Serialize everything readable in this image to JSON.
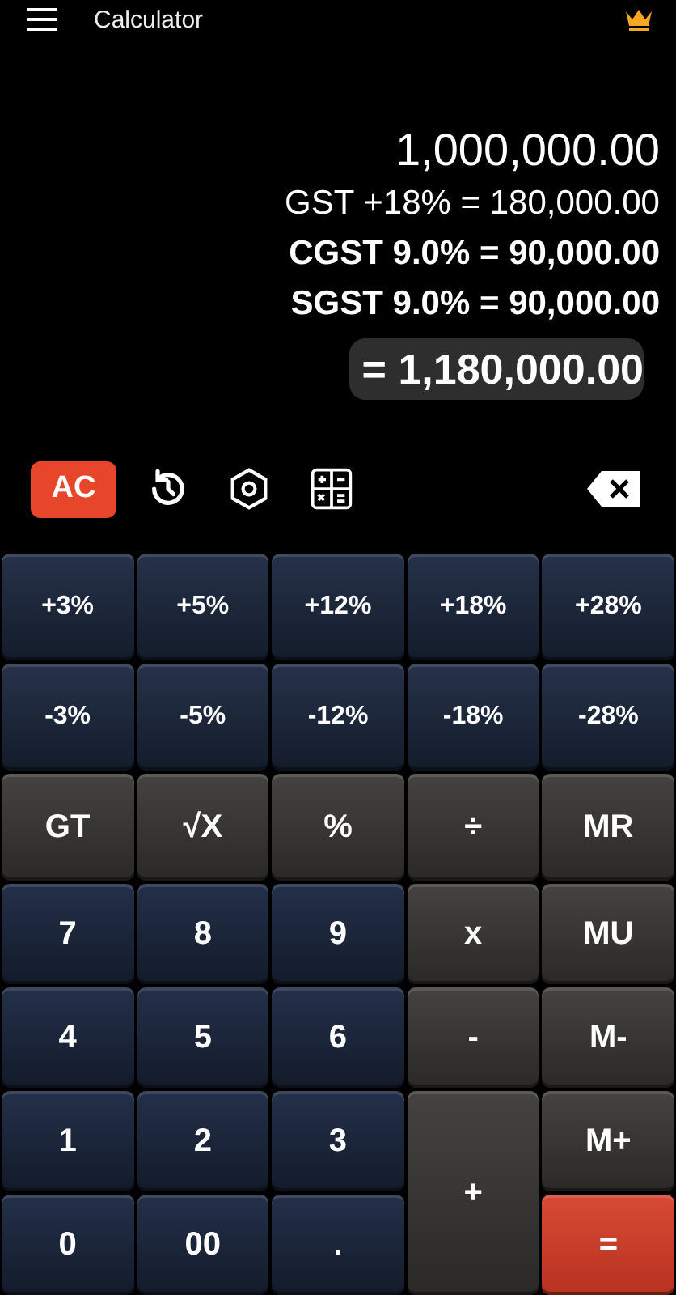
{
  "app_bar": {
    "title": "Calculator"
  },
  "display": {
    "input": "1,000,000.00",
    "lines": [
      {
        "text": "GST +18% = 180,000.00",
        "bold": false
      },
      {
        "text": "CGST 9.0% = 90,000.00",
        "bold": true
      },
      {
        "text": "SGST 9.0% = 90,000.00",
        "bold": true
      }
    ],
    "result": "= 1,180,000.00"
  },
  "toolbar": {
    "clear_button": "AC"
  },
  "keypad": [
    {
      "label": "+3%",
      "kind": "tax"
    },
    {
      "label": "+5%",
      "kind": "tax"
    },
    {
      "label": "+12%",
      "kind": "tax"
    },
    {
      "label": "+18%",
      "kind": "tax"
    },
    {
      "label": "+28%",
      "kind": "tax"
    },
    {
      "label": "-3%",
      "kind": "tax"
    },
    {
      "label": "-5%",
      "kind": "tax"
    },
    {
      "label": "-12%",
      "kind": "tax"
    },
    {
      "label": "-18%",
      "kind": "tax"
    },
    {
      "label": "-28%",
      "kind": "tax"
    },
    {
      "label": "GT",
      "kind": "function"
    },
    {
      "label": "√X",
      "kind": "function"
    },
    {
      "label": "%",
      "kind": "function"
    },
    {
      "label": "÷",
      "kind": "function"
    },
    {
      "label": "MR",
      "kind": "function"
    },
    {
      "label": "7",
      "kind": "digit"
    },
    {
      "label": "8",
      "kind": "digit"
    },
    {
      "label": "9",
      "kind": "digit"
    },
    {
      "label": "x",
      "kind": "function"
    },
    {
      "label": "MU",
      "kind": "function"
    },
    {
      "label": "4",
      "kind": "digit"
    },
    {
      "label": "5",
      "kind": "digit"
    },
    {
      "label": "6",
      "kind": "digit"
    },
    {
      "label": "-",
      "kind": "function"
    },
    {
      "label": "M-",
      "kind": "function"
    },
    {
      "label": "1",
      "kind": "digit"
    },
    {
      "label": "2",
      "kind": "digit"
    },
    {
      "label": "3",
      "kind": "digit"
    },
    {
      "label": "M+",
      "kind": "function"
    },
    {
      "label": "+",
      "kind": "tall"
    },
    {
      "label": "0",
      "kind": "digit"
    },
    {
      "label": "00",
      "kind": "digit"
    },
    {
      "label": ".",
      "kind": "digit"
    },
    {
      "label": "=",
      "kind": "equals"
    }
  ]
}
